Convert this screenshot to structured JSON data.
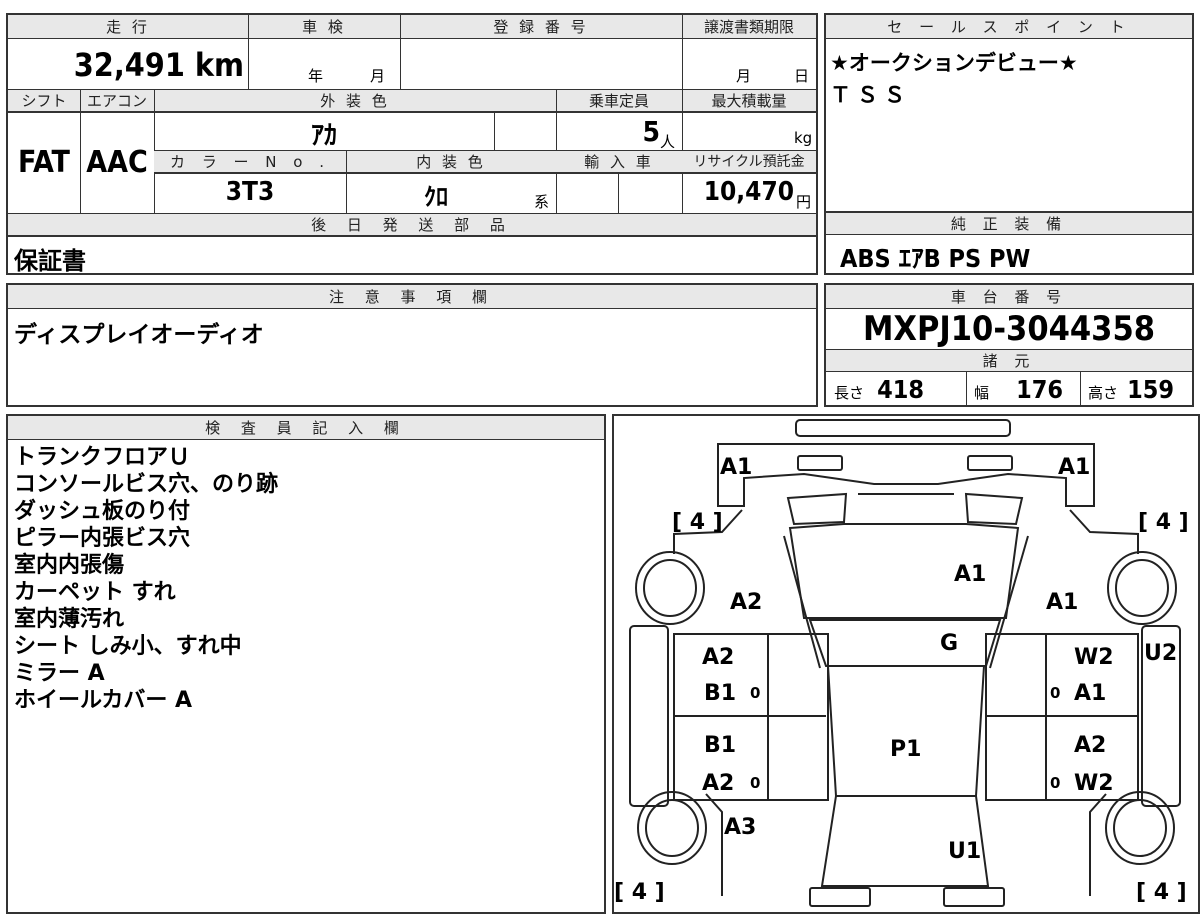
{
  "spec": {
    "headers": {
      "mileage": "走 行",
      "inspection": "車 検",
      "registration_no": "登 録 番 号",
      "transfer_deadline": "譲渡書類期限",
      "shift": "シフト",
      "aircon": "エアコン",
      "exterior_color": "外 装 色",
      "capacity": "乗車定員",
      "max_load": "最大積載量",
      "color_no": "カ ラ ー N o .",
      "interior_color": "内 装 色",
      "import": "輸 入 車",
      "recycle_fee": "リサイクル預託金",
      "later_parts": "後 日 発 送 部 品"
    },
    "mileage_value": "32,491",
    "mileage_unit": "km",
    "inspection_year": "年",
    "inspection_month": "月",
    "deadline_month": "月",
    "deadline_day": "日",
    "shift_value": "FAT",
    "aircon_value": "AAC",
    "exterior_color_value": "ｱｶ",
    "capacity_value": "5",
    "capacity_unit": "人",
    "max_load_unit": "kg",
    "color_no_value": "3T3",
    "interior_color_value": "ｸﾛ",
    "interior_color_suffix": "系",
    "recycle_fee_value": "10,470",
    "recycle_fee_unit": "円",
    "later_parts_value": "保証書"
  },
  "sales": {
    "header": "セ ー ル ス ポ イ ン ト",
    "lines": [
      "★オークションデビュー★",
      "ＴＳＳ"
    ]
  },
  "equipment": {
    "header": "純 正 装 備",
    "value": "ABS ｴｱB PS PW"
  },
  "notes": {
    "header": "注 意 事 項 欄",
    "value": "ディスプレイオーディオ"
  },
  "chassis": {
    "header": "車 台 番 号",
    "value": "MXPJ10-3044358",
    "dims_header": "諸 元",
    "length_label": "長さ",
    "length": "418",
    "width_label": "幅",
    "width": "176",
    "height_label": "高さ",
    "height": "159"
  },
  "inspector": {
    "header": "検 査 員 記 入 欄",
    "lines": [
      "トランクフロアＵ",
      "コンソールビス穴、のり跡",
      "ダッシュ板のり付",
      "ピラー内張ビス穴",
      "室内内張傷",
      "カーペット すれ",
      "室内薄汚れ",
      "シート しみ小、すれ中",
      "ミラー A",
      "ホイールカバー A"
    ]
  },
  "diagram": {
    "tire_tl": "[ 4 ]",
    "tire_tr": "[ 4 ]",
    "tire_bl": "[ 4 ]",
    "tire_br": "[ 4 ]",
    "front_left": "A1",
    "front_right": "A1",
    "hood": "A1",
    "fender_left": "A2",
    "fender_right": "A1",
    "windshield": "G",
    "side_right": "U2",
    "door_fl_1": "A2",
    "door_fl_2": "B1",
    "door_fr_1": "W2",
    "door_fr_2": "A1",
    "door_rl_1": "B1",
    "door_rl_2": "A2",
    "door_rr_1": "A2",
    "door_rr_2": "W2",
    "roof": "P1",
    "rear_left": "A3",
    "trunk": "U1",
    "zero": "0"
  }
}
